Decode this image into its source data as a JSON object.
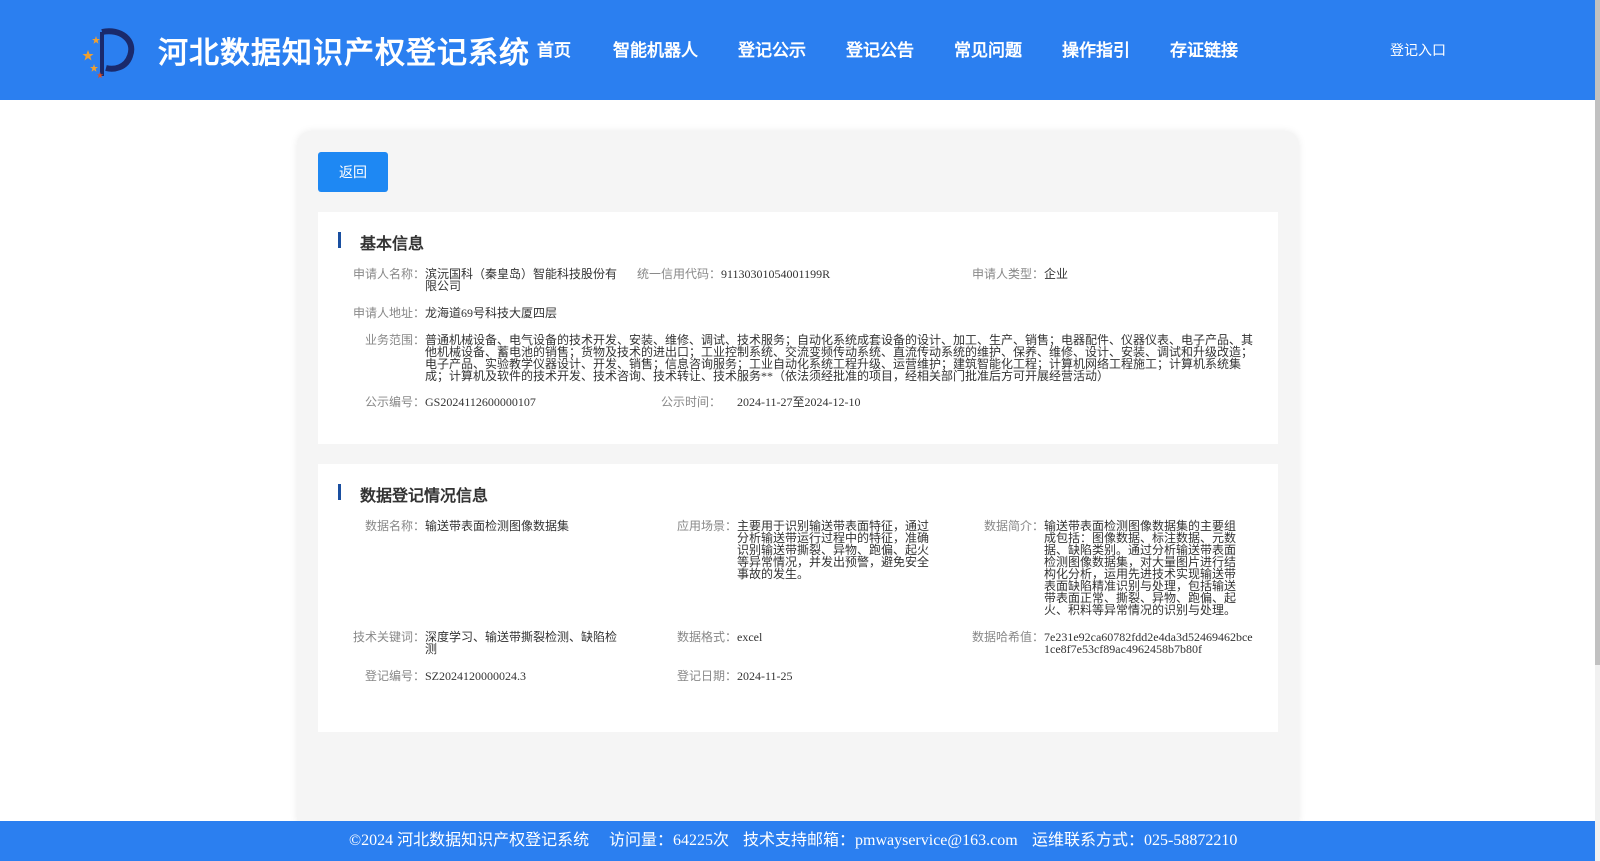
{
  "header": {
    "title": "河北数据知识产权登记系统",
    "nav": [
      "首页",
      "智能机器人",
      "登记公示",
      "登记公告",
      "常见问题",
      "操作指引",
      "存证链接"
    ],
    "login": "登记入口"
  },
  "panel": {
    "back_label": "返回"
  },
  "basic": {
    "title": "基本信息",
    "applicant_name_label": "申请人名称：",
    "applicant_name": "滨沅国科（秦皇岛）智能科技股份有限公司",
    "credit_code_label": "统一信用代码：",
    "credit_code": "91130301054001199R",
    "applicant_type_label": "申请人类型：",
    "applicant_type": "企业",
    "address_label": "申请人地址：",
    "address": "龙海道69号科技大厦四层",
    "scope_label": "业务范围：",
    "scope": "普通机械设备、电气设备的技术开发、安装、维修、调试、技术服务；自动化系统成套设备的设计、加工、生产、销售；电器配件、仪器仪表、电子产品、其他机械设备、蓄电池的销售；货物及技术的进出口；工业控制系统、交流变频传动系统、直流传动系统的维护、保养、维修、设计、安装、调试和升级改造；电子产品、实验教学仪器设计、开发、销售；信息咨询服务；工业自动化系统工程升级、运营维护；建筑智能化工程；计算机网络工程施工；计算机系统集成；计算机及软件的技术开发、技术咨询、技术转让、技术服务**（依法须经批准的项目，经相关部门批准后方可开展经营活动）",
    "notice_no_label": "公示编号：",
    "notice_no": "GS2024112600000107",
    "notice_time_label": "公示时间：",
    "notice_time": "2024-11-27至2024-12-10"
  },
  "data_info": {
    "title": "数据登记情况信息",
    "data_name_label": "数据名称：",
    "data_name": "输送带表面检测图像数据集",
    "scene_label": "应用场景：",
    "scene": "主要用于识别输送带表面特征，通过分析输送带运行过程中的特征，准确识别输送带撕裂、异物、跑偏、起火等异常情况，并发出预警，避免安全事故的发生。",
    "intro_label": "数据简介：",
    "intro": "输送带表面检测图像数据集的主要组成包括：图像数据、标注数据、元数据、缺陷类别。通过分析输送带表面检测图像数据集，对大量图片进行结构化分析，运用先进技术实现输送带表面缺陷精准识别与处理，包括输送带表面正常、撕裂、异物、跑偏、起火、积料等异常情况的识别与处理。",
    "keywords_label": "技术关键词：",
    "keywords": "深度学习、输送带撕裂检测、缺陷检测",
    "format_label": "数据格式：",
    "format": "excel",
    "hash_label": "数据哈希值：",
    "hash": "7e231e92ca60782fdd2e4da3d52469462bce1ce8f7e53cf89ac4962458b7b80f",
    "reg_no_label": "登记编号：",
    "reg_no": "SZ2024120000024.3",
    "reg_date_label": "登记日期：",
    "reg_date": "2024-11-25"
  },
  "footer": {
    "copyright": "©2024 河北数据知识产权登记系统",
    "visits": "访问量：64225次",
    "email": "技术支持邮箱：pmwayservice@163.com",
    "phone": "运维联系方式：025-58872210"
  },
  "colors": {
    "header": "#2b7ff0",
    "button": "#1e88f3",
    "title_bar": "#1a4fa0"
  }
}
